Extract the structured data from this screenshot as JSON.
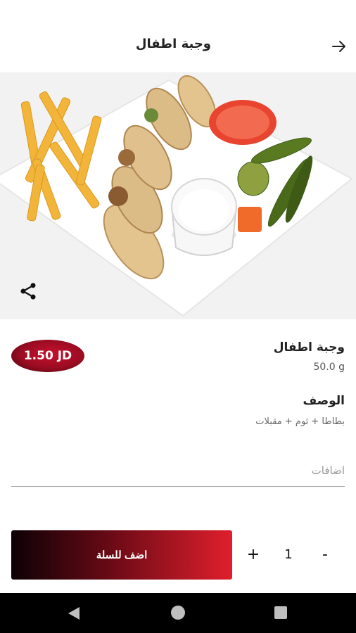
{
  "header": {
    "title": "وجبة اطفال",
    "back_icon": "arrow-right-icon"
  },
  "hero": {
    "image_alt": "shawarma wraps with fries, garlic sauce, pickles and tomato",
    "share_icon": "share-icon"
  },
  "product": {
    "name": "وجبة اطفال",
    "weight": "50.0 g",
    "price": "1.50 JD"
  },
  "description": {
    "title": "الوصف",
    "text": "بطاطا + ثوم + مقبلات"
  },
  "addons": {
    "label": "اضافات"
  },
  "cart": {
    "add_label": "اضف للسلة",
    "plus_label": "+",
    "quantity": "1",
    "minus_label": "-"
  },
  "colors": {
    "accent": "#e01f2c",
    "dark": "#0d0105"
  }
}
